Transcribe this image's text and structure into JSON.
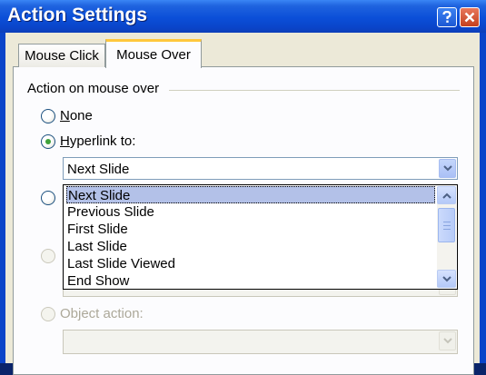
{
  "window": {
    "title": "Action Settings"
  },
  "tabs": [
    {
      "label": "Mouse Click",
      "active": false
    },
    {
      "label": "Mouse Over",
      "active": true
    }
  ],
  "group": {
    "title": "Action on mouse over"
  },
  "options": {
    "none": {
      "mnemonic": "N",
      "rest": "one",
      "selected": false
    },
    "hyperlink": {
      "mnemonic": "H",
      "rest": "yperlink to:",
      "selected": true
    },
    "object_action": {
      "label": "Object action:",
      "enabled": false
    }
  },
  "hyperlink_combo": {
    "value": "Next Slide"
  },
  "dropdown": {
    "items": [
      "Next Slide",
      "Previous Slide",
      "First Slide",
      "Last Slide",
      "Last Slide Viewed",
      "End Show"
    ],
    "selected_index": 0
  },
  "object_action_combo": {
    "value": ""
  },
  "colors": {
    "titlebar": "#0a44c9",
    "selection": "#b3c1e8",
    "radio_dot": "#3fa23a",
    "tab_highlight": "#ffc73c"
  }
}
